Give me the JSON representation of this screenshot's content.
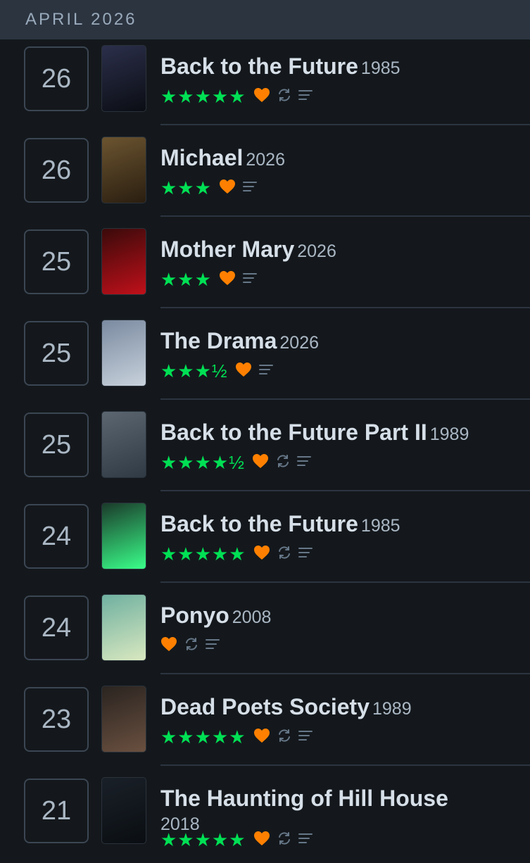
{
  "header": {
    "month": "APRIL 2026"
  },
  "entries": [
    {
      "day": "26",
      "title": "Back to the Future",
      "year": "1985",
      "stars": "★★★★★",
      "liked": true,
      "rewatch": true,
      "review": true
    },
    {
      "day": "26",
      "title": "Michael",
      "year": "2026",
      "stars": "★★★",
      "liked": true,
      "rewatch": false,
      "review": true
    },
    {
      "day": "25",
      "title": "Mother Mary",
      "year": "2026",
      "stars": "★★★",
      "liked": true,
      "rewatch": false,
      "review": true
    },
    {
      "day": "25",
      "title": "The Drama",
      "year": "2026",
      "stars": "★★★½",
      "liked": true,
      "rewatch": false,
      "review": true
    },
    {
      "day": "25",
      "title": "Back to the Future Part II",
      "year": "1989",
      "stars": "★★★★½",
      "liked": true,
      "rewatch": true,
      "review": true
    },
    {
      "day": "24",
      "title": "Back to the Future",
      "year": "1985",
      "stars": "★★★★★",
      "liked": true,
      "rewatch": true,
      "review": true
    },
    {
      "day": "24",
      "title": "Ponyo",
      "year": "2008",
      "stars": "",
      "liked": true,
      "rewatch": true,
      "review": true
    },
    {
      "day": "23",
      "title": "Dead Poets Society",
      "year": "1989",
      "stars": "★★★★★",
      "liked": true,
      "rewatch": true,
      "review": true
    },
    {
      "day": "21",
      "title": "The Haunting of Hill House",
      "year": "2018",
      "stars": "★★★★★",
      "liked": true,
      "rewatch": true,
      "review": true
    }
  ],
  "colors": {
    "star": "#00e054",
    "heart": "#ff8000",
    "icon": "#678"
  },
  "icons": {
    "like": "heart-icon",
    "rewatch": "rewatch-icon",
    "review": "review-icon"
  }
}
